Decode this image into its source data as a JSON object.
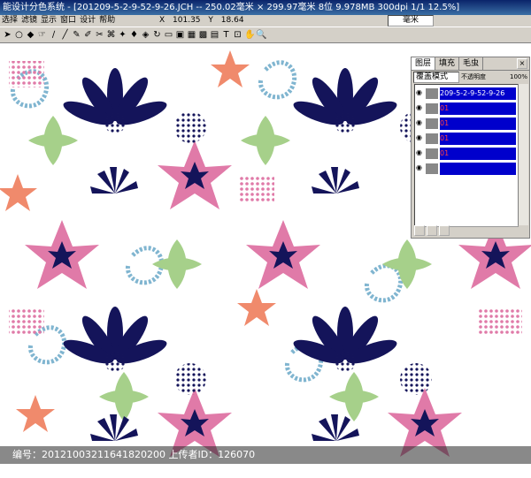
{
  "title": "能设计分色系统 - [201209-5-2-9-52-9-26.JCH -- 250.02毫米 × 299.97毫米 8位  9.978MB 300dpi 1/1  12.5%]",
  "menu": [
    "选择",
    "滤镜",
    "显示",
    "窗口",
    "设计",
    "帮助"
  ],
  "coords": {
    "x_label": "X",
    "x_value": "101.35",
    "y_label": "Y",
    "y_value": "18.64",
    "unit": "毫米"
  },
  "toolbar_icons": [
    "select-arrow-icon",
    "ellipse-icon",
    "eraser-icon",
    "hand-cursor-icon",
    "pen-icon",
    "line-icon",
    "pencil-icon",
    "brush-icon",
    "scissors-icon",
    "stamp-icon",
    "magic-icon",
    "drop-icon",
    "fill-icon",
    "rotate-icon",
    "rect-icon",
    "copy-icon",
    "grid-icon",
    "frame-icon",
    "hatch-icon",
    "text-icon",
    "measure-icon",
    "pan-hand-icon",
    "zoom-icon"
  ],
  "toolbar_glyphs": [
    "➤",
    "○",
    "◆",
    "☞",
    "∕",
    "╱",
    "✎",
    "✐",
    "✂",
    "⌘",
    "✦",
    "♦",
    "◈",
    "↻",
    "▭",
    "▣",
    "▦",
    "▩",
    "▤",
    "T",
    "⊡",
    "✋",
    "🔍"
  ],
  "layers_panel": {
    "tabs": [
      "图层",
      "填充",
      "毛虫"
    ],
    "blend_mode": "覆盖模式",
    "opacity_label": "不透明度",
    "opacity_value": "100%",
    "layers": [
      {
        "name": "209-5-2-9-52-9-26",
        "prefix": ""
      },
      {
        "name": "",
        "prefix": "01"
      },
      {
        "name": "",
        "prefix": "01"
      },
      {
        "name": "",
        "prefix": "01"
      },
      {
        "name": "",
        "prefix": "01"
      },
      {
        "name": "",
        "prefix": ""
      }
    ]
  },
  "watermark": "编号：20121003211641820200 上传者ID：126070",
  "palette": {
    "navy": "#14145a",
    "pink": "#e07aa8",
    "green": "#a6d08a",
    "salmon": "#f08a6c",
    "teal": "#6aa8c8",
    "bg": "#ffffff"
  }
}
